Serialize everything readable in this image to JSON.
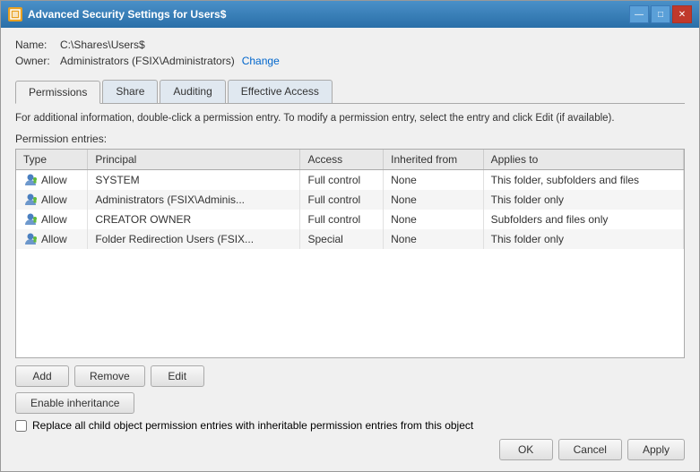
{
  "window": {
    "title": "Advanced Security Settings for Users$",
    "icon_label": "shield"
  },
  "title_controls": {
    "minimize": "—",
    "maximize": "□",
    "close": "✕"
  },
  "info": {
    "name_label": "Name:",
    "name_value": "C:\\Shares\\Users$",
    "owner_label": "Owner:",
    "owner_value": "Administrators (FSIX\\Administrators)",
    "change_link": "Change"
  },
  "tabs": [
    {
      "id": "permissions",
      "label": "Permissions",
      "active": true
    },
    {
      "id": "share",
      "label": "Share",
      "active": false
    },
    {
      "id": "auditing",
      "label": "Auditing",
      "active": false
    },
    {
      "id": "effective-access",
      "label": "Effective Access",
      "active": false
    }
  ],
  "permissions_tab": {
    "description": "For additional information, double-click a permission entry. To modify a permission entry, select the entry and click Edit (if available).",
    "entries_label": "Permission entries:",
    "columns": [
      {
        "id": "type",
        "label": "Type"
      },
      {
        "id": "principal",
        "label": "Principal"
      },
      {
        "id": "access",
        "label": "Access"
      },
      {
        "id": "inherited_from",
        "label": "Inherited from"
      },
      {
        "id": "applies_to",
        "label": "Applies to"
      }
    ],
    "rows": [
      {
        "type": "Allow",
        "principal": "SYSTEM",
        "access": "Full control",
        "inherited_from": "None",
        "applies_to": "This folder, subfolders and files"
      },
      {
        "type": "Allow",
        "principal": "Administrators (FSIX\\Adminis...",
        "access": "Full control",
        "inherited_from": "None",
        "applies_to": "This folder only"
      },
      {
        "type": "Allow",
        "principal": "CREATOR OWNER",
        "access": "Full control",
        "inherited_from": "None",
        "applies_to": "Subfolders and files only"
      },
      {
        "type": "Allow",
        "principal": "Folder Redirection Users (FSIX...",
        "access": "Special",
        "inherited_from": "None",
        "applies_to": "This folder only"
      }
    ],
    "buttons": {
      "add": "Add",
      "remove": "Remove",
      "edit": "Edit"
    },
    "enable_inheritance": "Enable inheritance",
    "replace_checkbox_label": "Replace all child object permission entries with inheritable permission entries from this object"
  },
  "footer": {
    "ok": "OK",
    "cancel": "Cancel",
    "apply": "Apply"
  }
}
